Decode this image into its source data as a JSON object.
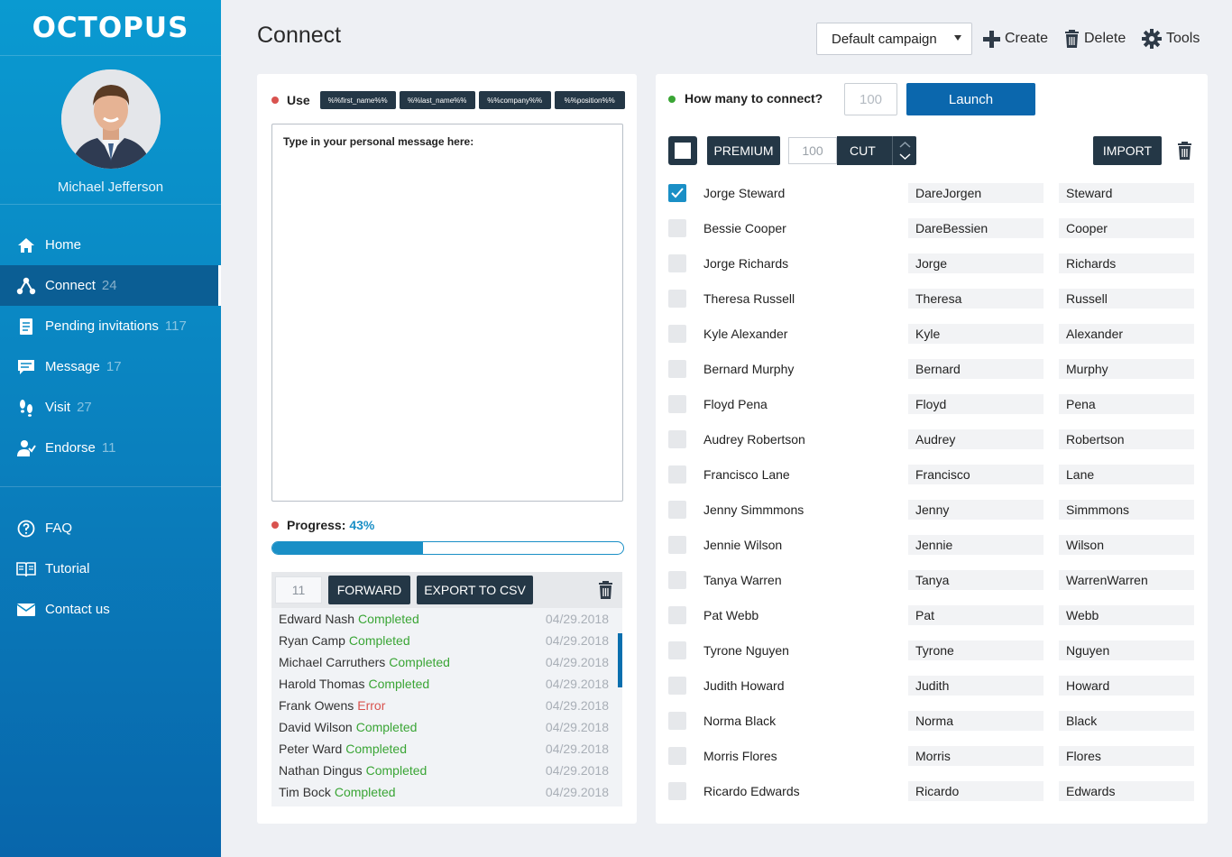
{
  "app": {
    "logo": "OCTOPUS",
    "user_name": "Michael Jefferson"
  },
  "nav": {
    "items": [
      {
        "label": "Home",
        "count": "",
        "icon": "home-icon"
      },
      {
        "label": "Connect",
        "count": "24",
        "icon": "connect-icon",
        "active": true
      },
      {
        "label": "Pending invitations",
        "count": "117",
        "icon": "document-icon"
      },
      {
        "label": "Message",
        "count": "17",
        "icon": "chat-icon"
      },
      {
        "label": "Visit",
        "count": "27",
        "icon": "footsteps-icon"
      },
      {
        "label": "Endorse",
        "count": "11",
        "icon": "endorse-icon"
      }
    ],
    "bottom": [
      {
        "label": "FAQ",
        "icon": "question-icon"
      },
      {
        "label": "Tutorial",
        "icon": "book-icon"
      },
      {
        "label": "Contact us",
        "icon": "mail-icon"
      }
    ]
  },
  "header": {
    "title": "Connect",
    "campaign": "Default campaign",
    "create_label": "Create",
    "delete_label": "Delete",
    "tools_label": "Tools"
  },
  "message": {
    "use_label": "Use",
    "tags": [
      "%%first_name%%",
      "%%last_name%%",
      "%%company%%",
      "%%position%%"
    ],
    "placeholder": "Type in your personal message here:",
    "progress_label": "Progress:",
    "progress_text": "43%",
    "progress_value": 0.43
  },
  "log": {
    "count": "11",
    "forward_label": "FORWARD",
    "export_label": "EXPORT TO CSV",
    "entries": [
      {
        "name": "Edward Nash",
        "status": "Completed",
        "date": "04/29.2018"
      },
      {
        "name": "Ryan Camp",
        "status": "Completed",
        "date": "04/29.2018"
      },
      {
        "name": "Michael Carruthers",
        "status": "Completed",
        "date": "04/29.2018"
      },
      {
        "name": "Harold Thomas",
        "status": "Completed",
        "date": "04/29.2018"
      },
      {
        "name": "Frank Owens",
        "status": "Error",
        "date": "04/29.2018"
      },
      {
        "name": "David Wilson",
        "status": "Completed",
        "date": "04/29.2018"
      },
      {
        "name": "Peter Ward",
        "status": "Completed",
        "date": "04/29.2018"
      },
      {
        "name": "Nathan Dingus",
        "status": "Completed",
        "date": "04/29.2018"
      },
      {
        "name": "Tim Bock",
        "status": "Completed",
        "date": "04/29.2018"
      }
    ]
  },
  "connect": {
    "question": "How many to connect?",
    "count_placeholder": "100",
    "launch_label": "Launch",
    "premium_label": "PREMIUM",
    "cut_value": "100",
    "cut_label": "CUT",
    "import_label": "IMPORT",
    "contacts": [
      {
        "name": "Jorge Steward",
        "first": "DareJorgen",
        "last": "Steward",
        "checked": true
      },
      {
        "name": "Bessie Cooper",
        "first": "DareBessien",
        "last": "Cooper",
        "checked": false
      },
      {
        "name": "Jorge Richards",
        "first": "Jorge",
        "last": "Richards",
        "checked": false
      },
      {
        "name": "Theresa Russell",
        "first": "Theresa",
        "last": "Russell",
        "checked": false
      },
      {
        "name": "Kyle Alexander",
        "first": "Kyle",
        "last": "Alexander",
        "checked": false
      },
      {
        "name": "Bernard Murphy",
        "first": "Bernard",
        "last": "Murphy",
        "checked": false
      },
      {
        "name": "Floyd Pena",
        "first": "Floyd",
        "last": "Pena",
        "checked": false
      },
      {
        "name": "Audrey Robertson",
        "first": "Audrey",
        "last": "Robertson",
        "checked": false
      },
      {
        "name": "Francisco Lane",
        "first": "Francisco",
        "last": "Lane",
        "checked": false
      },
      {
        "name": "Jenny Simmmons",
        "first": "Jenny",
        "last": "Simmmons",
        "checked": false
      },
      {
        "name": "Jennie Wilson",
        "first": "Jennie",
        "last": "Wilson",
        "checked": false
      },
      {
        "name": "Tanya Warren",
        "first": "Tanya",
        "last": "WarrenWarren",
        "checked": false
      },
      {
        "name": "Pat Webb",
        "first": "Pat",
        "last": "Webb",
        "checked": false
      },
      {
        "name": "Tyrone Nguyen",
        "first": "Tyrone",
        "last": "Nguyen",
        "checked": false
      },
      {
        "name": "Judith Howard",
        "first": "Judith",
        "last": "Howard",
        "checked": false
      },
      {
        "name": "Norma Black",
        "first": "Norma",
        "last": "Black",
        "checked": false
      },
      {
        "name": "Morris Flores",
        "first": "Morris",
        "last": "Flores",
        "checked": false
      },
      {
        "name": "Ricardo Edwards",
        "first": "Ricardo",
        "last": "Edwards",
        "checked": false
      }
    ]
  },
  "colors": {
    "completed": "#3aa535",
    "error": "#d9534f",
    "accent": "#1a8fc6",
    "dark": "#243746"
  }
}
